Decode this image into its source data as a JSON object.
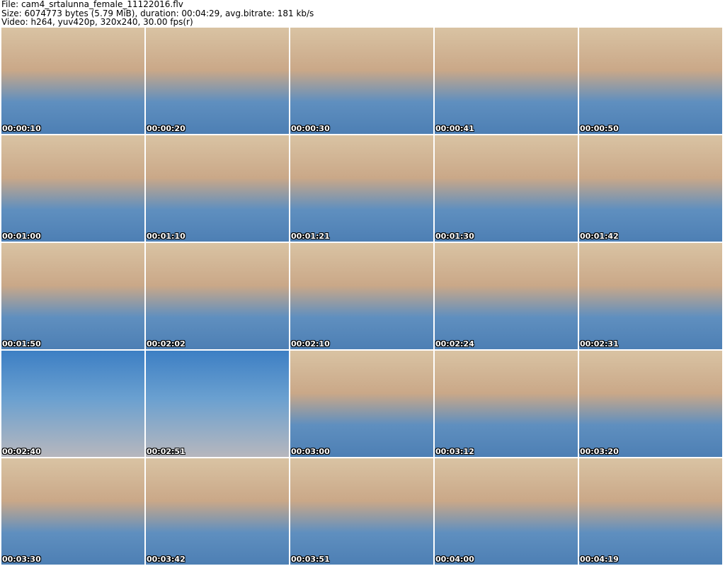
{
  "header": {
    "file_line": "File: cam4_srtalunna_female_11122016.flv",
    "size_line": "Size: 6074773 bytes (5.79 MiB), duration: 00:04:29, avg.bitrate: 181 kb/s",
    "video_line": "Video: h264, yuv420p, 320x240, 30.00 fps(r)"
  },
  "thumbnails": [
    {
      "timestamp": "00:00:10"
    },
    {
      "timestamp": "00:00:20"
    },
    {
      "timestamp": "00:00:30"
    },
    {
      "timestamp": "00:00:41"
    },
    {
      "timestamp": "00:00:50"
    },
    {
      "timestamp": "00:01:00"
    },
    {
      "timestamp": "00:01:10"
    },
    {
      "timestamp": "00:01:21"
    },
    {
      "timestamp": "00:01:30"
    },
    {
      "timestamp": "00:01:42"
    },
    {
      "timestamp": "00:01:50"
    },
    {
      "timestamp": "00:02:02"
    },
    {
      "timestamp": "00:02:10"
    },
    {
      "timestamp": "00:02:24"
    },
    {
      "timestamp": "00:02:31"
    },
    {
      "timestamp": "00:02:40"
    },
    {
      "timestamp": "00:02:51"
    },
    {
      "timestamp": "00:03:00"
    },
    {
      "timestamp": "00:03:12"
    },
    {
      "timestamp": "00:03:20"
    },
    {
      "timestamp": "00:03:30"
    },
    {
      "timestamp": "00:03:42"
    },
    {
      "timestamp": "00:03:51"
    },
    {
      "timestamp": "00:04:00"
    },
    {
      "timestamp": "00:04:19"
    }
  ]
}
